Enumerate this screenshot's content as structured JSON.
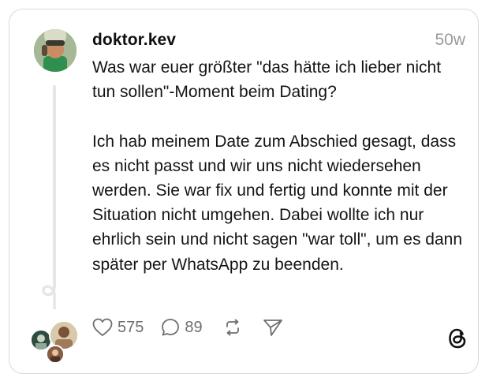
{
  "post": {
    "username": "doktor.kev",
    "time": "50w",
    "text": "Was war euer größter \"das hätte ich lieber nicht tun sollen\"-Moment beim Dating?\n\nIch hab meinem Date zum Abschied gesagt, dass es nicht passt und wir uns nicht wiedersehen werden. Sie war fix und fertig und konnte mit der Situation nicht umgehen. Dabei wollte ich nur ehrlich sein und nicht sagen \"war toll\", um es dann später per WhatsApp zu beenden.",
    "likes": "575",
    "replies": "89"
  },
  "icons": {
    "like": "heart-icon",
    "reply": "speech-bubble-icon",
    "repost": "repost-arrows-icon",
    "share": "paper-plane-icon",
    "brand": "threads-logo-icon"
  },
  "colors": {
    "border": "#d9d9d9",
    "muted_text": "#9a9a9a",
    "icon": "#6f6f6f",
    "thread_line": "#e6e6e6"
  }
}
